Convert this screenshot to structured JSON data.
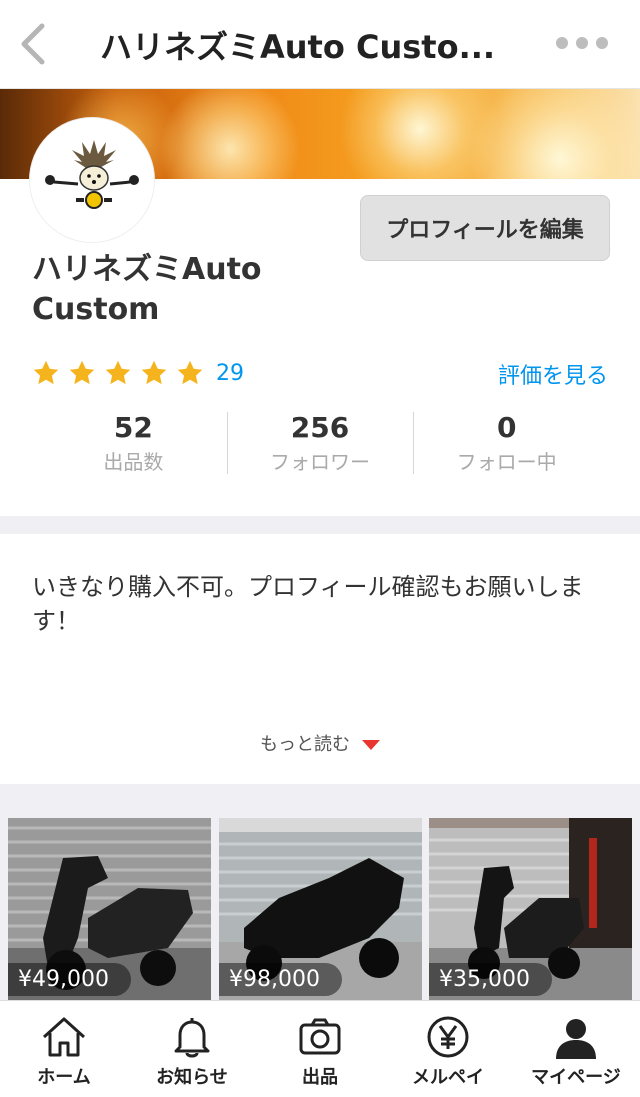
{
  "nav": {
    "title": "ハリネズミAuto Custo...",
    "back_icon": "chevron-left-icon",
    "more_icon": "more-dots-icon"
  },
  "profile": {
    "logo_text_top": "ハリネズミ",
    "logo_text_bottom": "Auto Custom",
    "edit_button": "プロフィールを編集",
    "name_line1": "ハリネズミAuto",
    "name_line2": "Custom",
    "stars": 5,
    "rating_count": "29",
    "see_reviews": "評価を見る",
    "star_color": "#f5b41d",
    "link_color": "#0095ee"
  },
  "stats": [
    {
      "value": "52",
      "label": "出品数"
    },
    {
      "value": "256",
      "label": "フォロワー"
    },
    {
      "value": "0",
      "label": "フォロー中"
    }
  ],
  "bio": {
    "text": "いきなり購入不可。プロフィール確認もお願いします！",
    "read_more": "もっと読む"
  },
  "items": [
    {
      "price": "¥49,000"
    },
    {
      "price": "¥98,000"
    },
    {
      "price": "¥35,000"
    }
  ],
  "tabs": [
    {
      "label": "ホーム",
      "icon": "home-icon"
    },
    {
      "label": "お知らせ",
      "icon": "bell-icon"
    },
    {
      "label": "出品",
      "icon": "camera-icon"
    },
    {
      "label": "メルペイ",
      "icon": "yen-icon"
    },
    {
      "label": "マイページ",
      "icon": "person-icon"
    }
  ]
}
